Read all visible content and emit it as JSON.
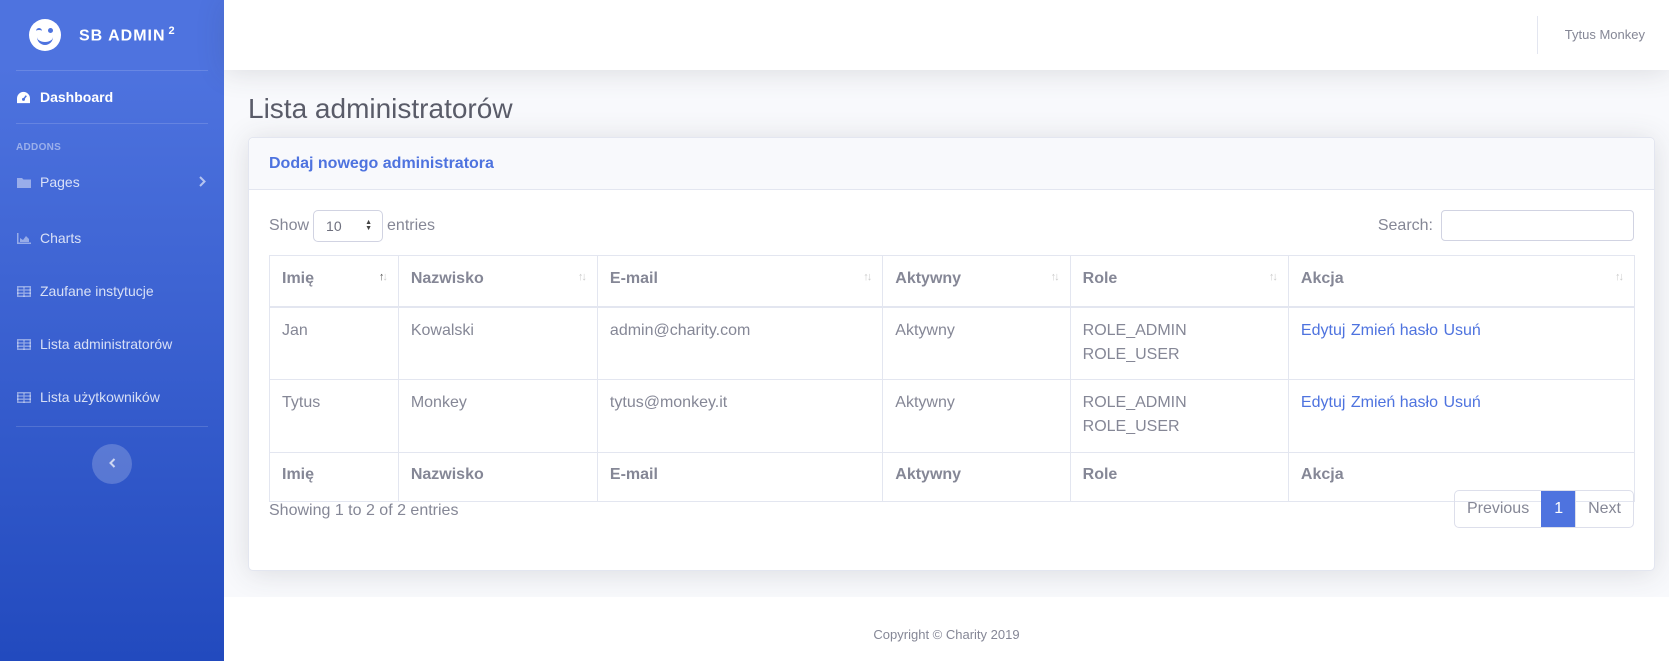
{
  "brand": {
    "name": "SB Admin",
    "sup": "2"
  },
  "sidebar": {
    "heading": "Addons",
    "items": [
      {
        "label": "Dashboard",
        "icon": "tachometer-icon"
      },
      {
        "label": "Pages",
        "icon": "folder-icon"
      },
      {
        "label": "Charts",
        "icon": "chart-area-icon"
      },
      {
        "label": "Zaufane instytucje",
        "icon": "table-icon"
      },
      {
        "label": "Lista administratorów",
        "icon": "table-icon"
      },
      {
        "label": "Lista użytkowników",
        "icon": "table-icon"
      }
    ],
    "toggle_icon": "chevron-left-icon"
  },
  "topbar": {
    "user_name": "Tytus Monkey"
  },
  "page": {
    "title": "Lista administratorów"
  },
  "card": {
    "header_link": "Dodaj nowego administratora"
  },
  "table_controls": {
    "show_label": "Show",
    "entries_value": "10",
    "entries_label": "entries",
    "search_label": "Search:",
    "search_value": ""
  },
  "table": {
    "columns": [
      "Imię",
      "Nazwisko",
      "E-mail",
      "Aktywny",
      "Role",
      "Akcja"
    ],
    "rows": [
      {
        "first": "Jan",
        "last": "Kowalski",
        "email": "admin@charity.com",
        "active": "Aktywny",
        "role1": "ROLE_ADMIN",
        "role2": "ROLE_USER"
      },
      {
        "first": "Tytus",
        "last": "Monkey",
        "email": "tytus@monkey.it",
        "active": "Aktywny",
        "role1": "ROLE_ADMIN",
        "role2": "ROLE_USER"
      }
    ],
    "actions": {
      "edit": "Edytuj",
      "change_password": "Zmień hasło",
      "delete": "Usuń"
    }
  },
  "pagination": {
    "info": "Showing 1 to 2 of 2 entries",
    "previous": "Previous",
    "current": "1",
    "next": "Next"
  },
  "footer": {
    "copyright": "Copyright © Charity 2019"
  },
  "colors": {
    "primary": "#4e73df",
    "sidebar_end": "#224abe",
    "text": "#858796"
  }
}
